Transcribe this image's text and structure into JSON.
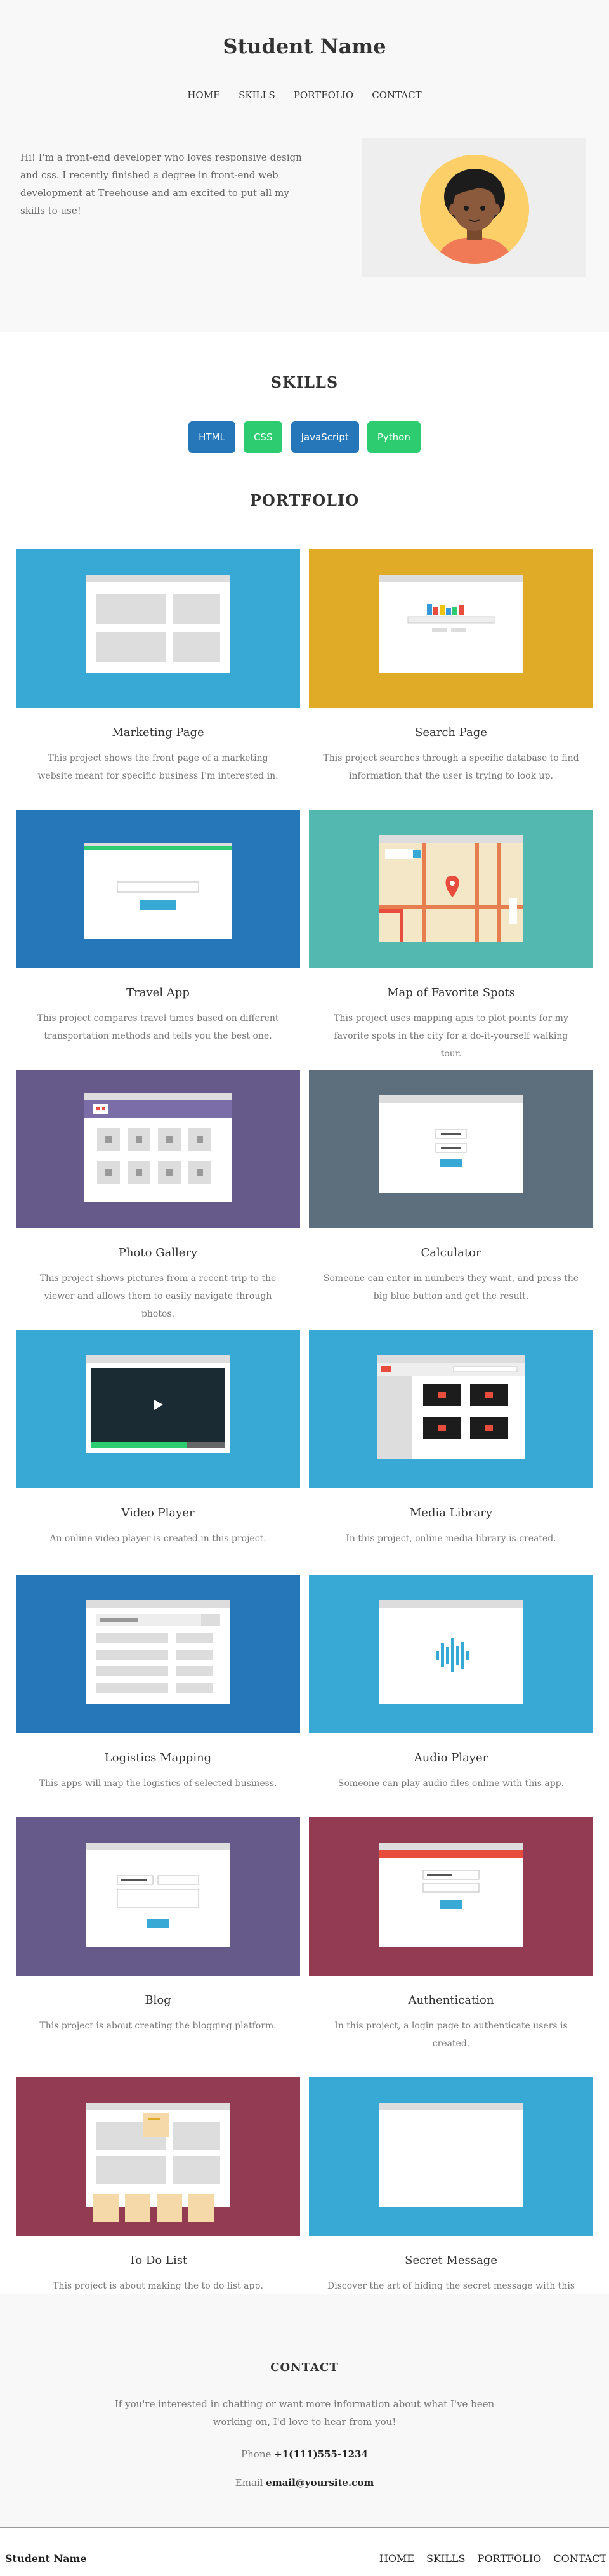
{
  "header": {
    "site_name": "Student Name",
    "nav": [
      "HOME",
      "SKILLS",
      "PORTFOLIO",
      "CONTACT"
    ],
    "intro": "Hi! I'm a front-end developer who loves responsive design and css. I recently finished a degree in front-end web development at Treehouse and am excited to put all my skills to use!"
  },
  "skills": {
    "title": "SKILLS",
    "items": [
      {
        "label": "HTML",
        "color": "#2577b9"
      },
      {
        "label": "CSS",
        "color": "#2ecc71"
      },
      {
        "label": "JavaScript",
        "color": "#2577b9"
      },
      {
        "label": "Python",
        "color": "#2ecc71"
      }
    ]
  },
  "portfolio": {
    "title": "PORTFOLIO",
    "projects": [
      {
        "title": "Marketing Page",
        "desc": "This project shows the front page of a marketing website meant for specific business I'm interested in.",
        "bg": "#38a9d4",
        "icon": "marketing-page-illustration"
      },
      {
        "title": "Search Page",
        "desc": "This project searches through a specific database to find information that the user is trying to look up.",
        "bg": "#e0ab26",
        "icon": "search-page-illustration"
      },
      {
        "title": "Travel App",
        "desc": "This project compares travel times based on different transportation methods and tells you the best one.",
        "bg": "#2577b9",
        "icon": "travel-app-illustration"
      },
      {
        "title": "Map of Favorite Spots",
        "desc": "This project uses mapping apis to plot points for my favorite spots in the city for a do-it-yourself walking tour.",
        "bg": "#52b8b0",
        "icon": "map-illustration"
      },
      {
        "title": "Photo Gallery",
        "desc": "This project shows pictures from a recent trip to the viewer and allows them to easily navigate through photos.",
        "bg": "#665a8b",
        "icon": "photo-gallery-illustration"
      },
      {
        "title": "Calculator",
        "desc": "Someone can enter in numbers they want, and press the big blue button and get the result.",
        "bg": "#5d6e7d",
        "icon": "calculator-illustration"
      },
      {
        "title": "Video Player",
        "desc": "An online video player is created in this project.",
        "bg": "#38a9d4",
        "icon": "video-player-illustration"
      },
      {
        "title": "Media Library",
        "desc": "In this project, online media library is created.",
        "bg": "#38a9d4",
        "icon": "media-library-illustration"
      },
      {
        "title": "Logistics Mapping",
        "desc": "This apps will map the logistics of selected business.",
        "bg": "#2577b9",
        "icon": "logistics-illustration"
      },
      {
        "title": "Audio Player",
        "desc": "Someone can play audio files online with this app.",
        "bg": "#38a9d4",
        "icon": "audio-player-illustration"
      },
      {
        "title": "Blog",
        "desc": "This project is about creating the blogging platform.",
        "bg": "#665a8b",
        "icon": "blog-illustration"
      },
      {
        "title": "Authentication",
        "desc": "In this project, a login page to authenticate users is created.",
        "bg": "#933b52",
        "icon": "authentication-illustration"
      },
      {
        "title": "To Do List",
        "desc": "This project is about making the to do list app.",
        "bg": "#933b52",
        "icon": "todo-illustration"
      },
      {
        "title": "Secret Message",
        "desc": "Discover the art of hiding the secret message with this app.",
        "bg": "#38a9d4",
        "icon": "secret-message-illustration"
      }
    ]
  },
  "contact": {
    "title": "CONTACT",
    "text": "If you're interested in chatting or want more information about what I've been working on, I'd love to hear from you!",
    "phone_label": "Phone",
    "phone": "+1(111)555-1234",
    "email_label": "Email",
    "email": "email@yoursite.com"
  },
  "footer": {
    "name": "Student Name",
    "nav": [
      "HOME",
      "SKILLS",
      "PORTFOLIO",
      "CONTACT"
    ]
  }
}
